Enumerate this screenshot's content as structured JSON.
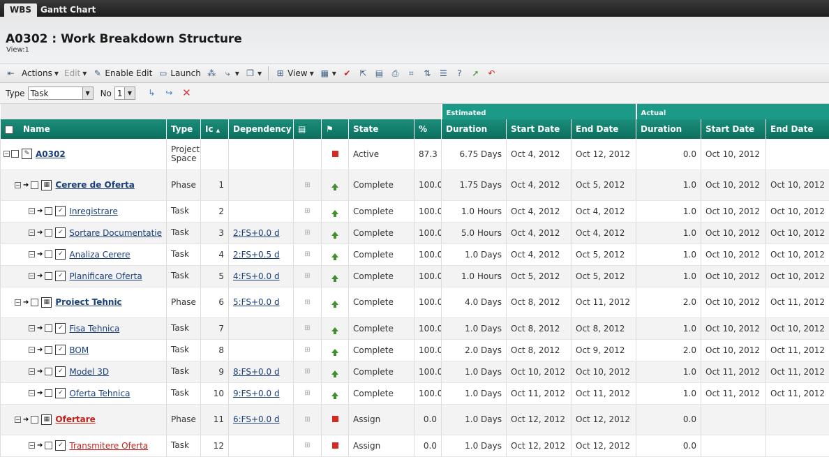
{
  "tabs": [
    {
      "label": "WBS",
      "active": true
    },
    {
      "label": "Gantt Chart",
      "active": false
    }
  ],
  "header": {
    "title": "A0302 : Work Breakdown Structure",
    "view": "View:1"
  },
  "toolbar": {
    "actions": "Actions",
    "edit": "Edit",
    "enable_edit": "Enable Edit",
    "launch": "Launch",
    "view": "View"
  },
  "filter": {
    "type_label": "Type",
    "type_value": "Task",
    "no_label": "No",
    "no_value": "1"
  },
  "columns": {
    "group_estimated": "Estimated",
    "group_actual": "Actual",
    "name": "Name",
    "type": "Type",
    "id": "Ic",
    "dependency": "Dependency",
    "state": "State",
    "pct": "%",
    "est_duration": "Duration",
    "est_start": "Start Date",
    "est_end": "End Date",
    "act_duration": "Duration",
    "act_start": "Start Date",
    "act_end": "End Date"
  },
  "colors": {
    "header_teal": "#0d6f5f",
    "estimated_band": "#1a9a87",
    "link": "#1a3f7a",
    "assign_red": "#c0221b"
  },
  "rows": [
    {
      "name": "A0302",
      "type": "Project Space",
      "id": "",
      "dep": "",
      "state": "Active",
      "icon": "red-square",
      "pct": "87.3",
      "ed": "6.75 Days",
      "es": "Oct 4, 2012",
      "ee": "Oct 12, 2012",
      "ad": "0.0",
      "as": "Oct 10, 2012",
      "ae": ""
    },
    {
      "name": "Cerere de Oferta",
      "type": "Phase",
      "id": "1",
      "dep": "",
      "state": "Complete",
      "icon": "green-arrow",
      "pct": "100.0",
      "ed": "1.75 Days",
      "es": "Oct 4, 2012",
      "ee": "Oct 5, 2012",
      "ad": "1.0",
      "as": "Oct 10, 2012",
      "ae": "Oct 10, 2012"
    },
    {
      "name": "Inregistrare",
      "type": "Task",
      "id": "2",
      "dep": "",
      "state": "Complete",
      "icon": "green-arrow",
      "pct": "100.0",
      "ed": "1.0 Hours",
      "es": "Oct 4, 2012",
      "ee": "Oct 4, 2012",
      "ad": "1.0",
      "as": "Oct 10, 2012",
      "ae": "Oct 10, 2012"
    },
    {
      "name": "Sortare Documentatie",
      "type": "Task",
      "id": "3",
      "dep": "2:FS+0.0 d",
      "state": "Complete",
      "icon": "green-arrow",
      "pct": "100.0",
      "ed": "5.0 Hours",
      "es": "Oct 4, 2012",
      "ee": "Oct 4, 2012",
      "ad": "1.0",
      "as": "Oct 10, 2012",
      "ae": "Oct 10, 2012"
    },
    {
      "name": "Analiza Cerere",
      "type": "Task",
      "id": "4",
      "dep": "2:FS+0.5 d",
      "state": "Complete",
      "icon": "green-arrow",
      "pct": "100.0",
      "ed": "1.0 Days",
      "es": "Oct 4, 2012",
      "ee": "Oct 5, 2012",
      "ad": "1.0",
      "as": "Oct 10, 2012",
      "ae": "Oct 10, 2012"
    },
    {
      "name": "Planificare Oferta",
      "type": "Task",
      "id": "5",
      "dep": "4:FS+0.0 d",
      "state": "Complete",
      "icon": "green-arrow",
      "pct": "100.0",
      "ed": "1.0 Hours",
      "es": "Oct 5, 2012",
      "ee": "Oct 5, 2012",
      "ad": "1.0",
      "as": "Oct 10, 2012",
      "ae": "Oct 10, 2012"
    },
    {
      "name": "Proiect Tehnic",
      "type": "Phase",
      "id": "6",
      "dep": "5:FS+0.0 d",
      "state": "Complete",
      "icon": "green-arrow",
      "pct": "100.0",
      "ed": "4.0 Days",
      "es": "Oct 8, 2012",
      "ee": "Oct 11, 2012",
      "ad": "2.0",
      "as": "Oct 10, 2012",
      "ae": "Oct 11, 2012"
    },
    {
      "name": "Fisa Tehnica",
      "type": "Task",
      "id": "7",
      "dep": "",
      "state": "Complete",
      "icon": "green-arrow",
      "pct": "100.0",
      "ed": "1.0 Days",
      "es": "Oct 8, 2012",
      "ee": "Oct 8, 2012",
      "ad": "1.0",
      "as": "Oct 10, 2012",
      "ae": "Oct 10, 2012"
    },
    {
      "name": "BOM",
      "type": "Task",
      "id": "8",
      "dep": "",
      "state": "Complete",
      "icon": "green-arrow",
      "pct": "100.0",
      "ed": "2.0 Days",
      "es": "Oct 8, 2012",
      "ee": "Oct 9, 2012",
      "ad": "2.0",
      "as": "Oct 10, 2012",
      "ae": "Oct 11, 2012"
    },
    {
      "name": "Model 3D",
      "type": "Task",
      "id": "9",
      "dep": "8:FS+0.0 d",
      "state": "Complete",
      "icon": "green-arrow",
      "pct": "100.0",
      "ed": "1.0 Days",
      "es": "Oct 10, 2012",
      "ee": "Oct 10, 2012",
      "ad": "1.0",
      "as": "Oct 11, 2012",
      "ae": "Oct 11, 2012"
    },
    {
      "name": "Oferta Tehnica",
      "type": "Task",
      "id": "10",
      "dep": "9:FS+0.0 d",
      "state": "Complete",
      "icon": "green-arrow",
      "pct": "100.0",
      "ed": "1.0 Days",
      "es": "Oct 11, 2012",
      "ee": "Oct 11, 2012",
      "ad": "1.0",
      "as": "Oct 11, 2012",
      "ae": "Oct 11, 2012"
    },
    {
      "name": "Ofertare",
      "type": "Phase",
      "id": "11",
      "dep": "6:FS+0.0 d",
      "state": "Assign",
      "icon": "red-square",
      "pct": "0.0",
      "ed": "1.0 Days",
      "es": "Oct 12, 2012",
      "ee": "Oct 12, 2012",
      "ad": "0.0",
      "as": "",
      "ae": ""
    },
    {
      "name": "Transmitere Oferta",
      "type": "Task",
      "id": "12",
      "dep": "",
      "state": "Assign",
      "icon": "red-square",
      "pct": "0.0",
      "ed": "1.0 Days",
      "es": "Oct 12, 2012",
      "ee": "Oct 12, 2012",
      "ad": "0.0",
      "as": "",
      "ae": ""
    }
  ]
}
